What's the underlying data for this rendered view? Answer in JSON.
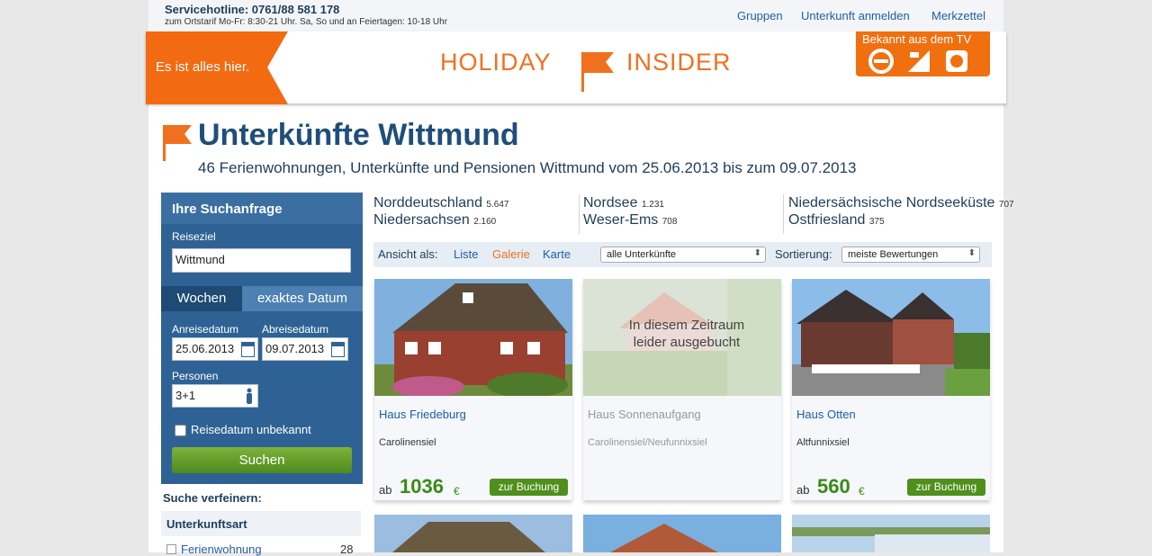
{
  "topbar": {
    "hotline": "Servicehotline: 0761/88 581 178",
    "hotline_sub": "zum Ortstarif Mo-Fr: 8:30-21 Uhr. Sa, So und an Feiertagen: 10-18 Uhr",
    "links": [
      "Gruppen",
      "Unterkunft anmelden",
      "Merkzettel"
    ]
  },
  "header": {
    "tagline": "Es ist alles hier.",
    "logo_left": "HOLIDAY",
    "logo_right": "INSIDER",
    "tv_text": "Bekannt aus dem TV",
    "brand_color": "#f07020"
  },
  "page": {
    "title": "Unterkünfte Wittmund",
    "subtitle": "46 Ferienwohnungen, Unterkünfte und Pensionen Wittmund vom 25.06.2013 bis zum 09.07.2013"
  },
  "search": {
    "heading": "Ihre Suchanfrage",
    "destination_label": "Reiseziel",
    "destination_value": "Wittmund",
    "tab_weeks": "Wochen",
    "tab_exact": "exaktes Datum",
    "arrival_label": "Anreisedatum",
    "arrival_value": "25.06.2013",
    "departure_label": "Abreisedatum",
    "departure_value": "09.07.2013",
    "persons_label": "Personen",
    "persons_value": "3+1",
    "unknown_date_label": "Reisedatum unbekannt",
    "submit": "Suchen"
  },
  "refine": {
    "heading": "Suche verfeinern:",
    "section": "Unterkunftsart",
    "items": [
      {
        "label": "Ferienwohnung",
        "count": "28"
      }
    ]
  },
  "regions": [
    {
      "name": "Norddeutschland",
      "count": "5.647"
    },
    {
      "name": "Niedersachsen",
      "count": "2.160"
    },
    {
      "name": "Nordsee",
      "count": "1.231"
    },
    {
      "name": "Weser-Ems",
      "count": "708"
    },
    {
      "name": "Niedersächsische Nordseeküste",
      "count": "707"
    },
    {
      "name": "Ostfriesland",
      "count": "375"
    }
  ],
  "viewbar": {
    "label": "Ansicht als:",
    "views": [
      "Liste",
      "Galerie",
      "Karte"
    ],
    "active_view": "Galerie",
    "filter_value": "alle Unterkünfte",
    "sort_label": "Sortierung:",
    "sort_value": "meiste Bewertungen"
  },
  "cards": [
    {
      "name": "Haus Friedeburg",
      "location": "Carolinensiel",
      "price_prefix": "ab",
      "price": "1036",
      "currency": "€",
      "book": "zur Buchung"
    },
    {
      "name": "Haus Sonnenaufgang",
      "location": "Carolinensiel/Neufunnixsiel",
      "overlay": "In diesem Zeitraum leider ausgebucht"
    },
    {
      "name": "Haus Otten",
      "location": "Altfunnixsiel",
      "price_prefix": "ab",
      "price": "560",
      "currency": "€",
      "book": "zur Buchung"
    }
  ]
}
